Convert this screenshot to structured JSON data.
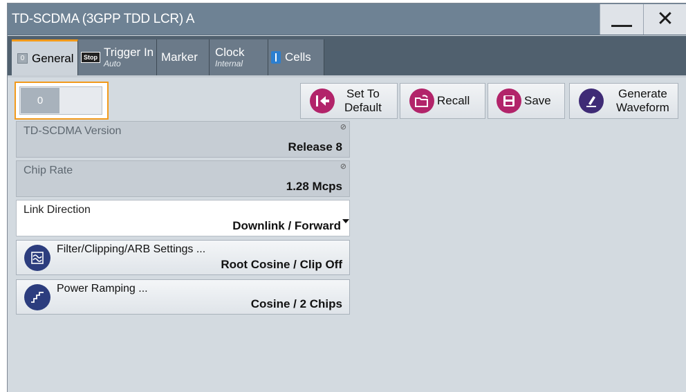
{
  "window": {
    "title": "TD-SCDMA (3GPP TDD LCR) A",
    "minimize_icon": "minimize-icon",
    "close_label": "✕"
  },
  "tabs": [
    {
      "led": "0",
      "label": "General",
      "sub": ""
    },
    {
      "badge": "Stop",
      "label": "Trigger In",
      "sub": "Auto"
    },
    {
      "label": "Marker",
      "sub": ""
    },
    {
      "label": "Clock",
      "sub": "Internal"
    },
    {
      "label": "Cells",
      "sub": ""
    }
  ],
  "state_toggle": {
    "value": "0"
  },
  "actions": {
    "set_default": "Set To\nDefault",
    "set_default_a": "Set To",
    "set_default_b": "Default",
    "recall": "Recall",
    "save": "Save",
    "generate_a": "Generate",
    "generate_b": "Waveform"
  },
  "fields": {
    "version": {
      "label": "TD-SCDMA Version",
      "value": "Release 8"
    },
    "chip_rate": {
      "label": "Chip Rate",
      "value": "1.28 Mcps"
    },
    "link_direction": {
      "label": "Link Direction",
      "value": "Downlink / Forward"
    }
  },
  "sub_dialogs": {
    "filter": {
      "title": "Filter/Clipping/ARB Settings ...",
      "value": "Root Cosine / Clip Off"
    },
    "power": {
      "title": "Power Ramping ...",
      "value": "Cosine /  2 Chips"
    }
  },
  "colors": {
    "accent": "#f29a1b",
    "title_bar": "#6e8294",
    "tab_bar": "#50606e",
    "action_icon": "#b2246a",
    "sub_icon": "#2c3d7e"
  }
}
